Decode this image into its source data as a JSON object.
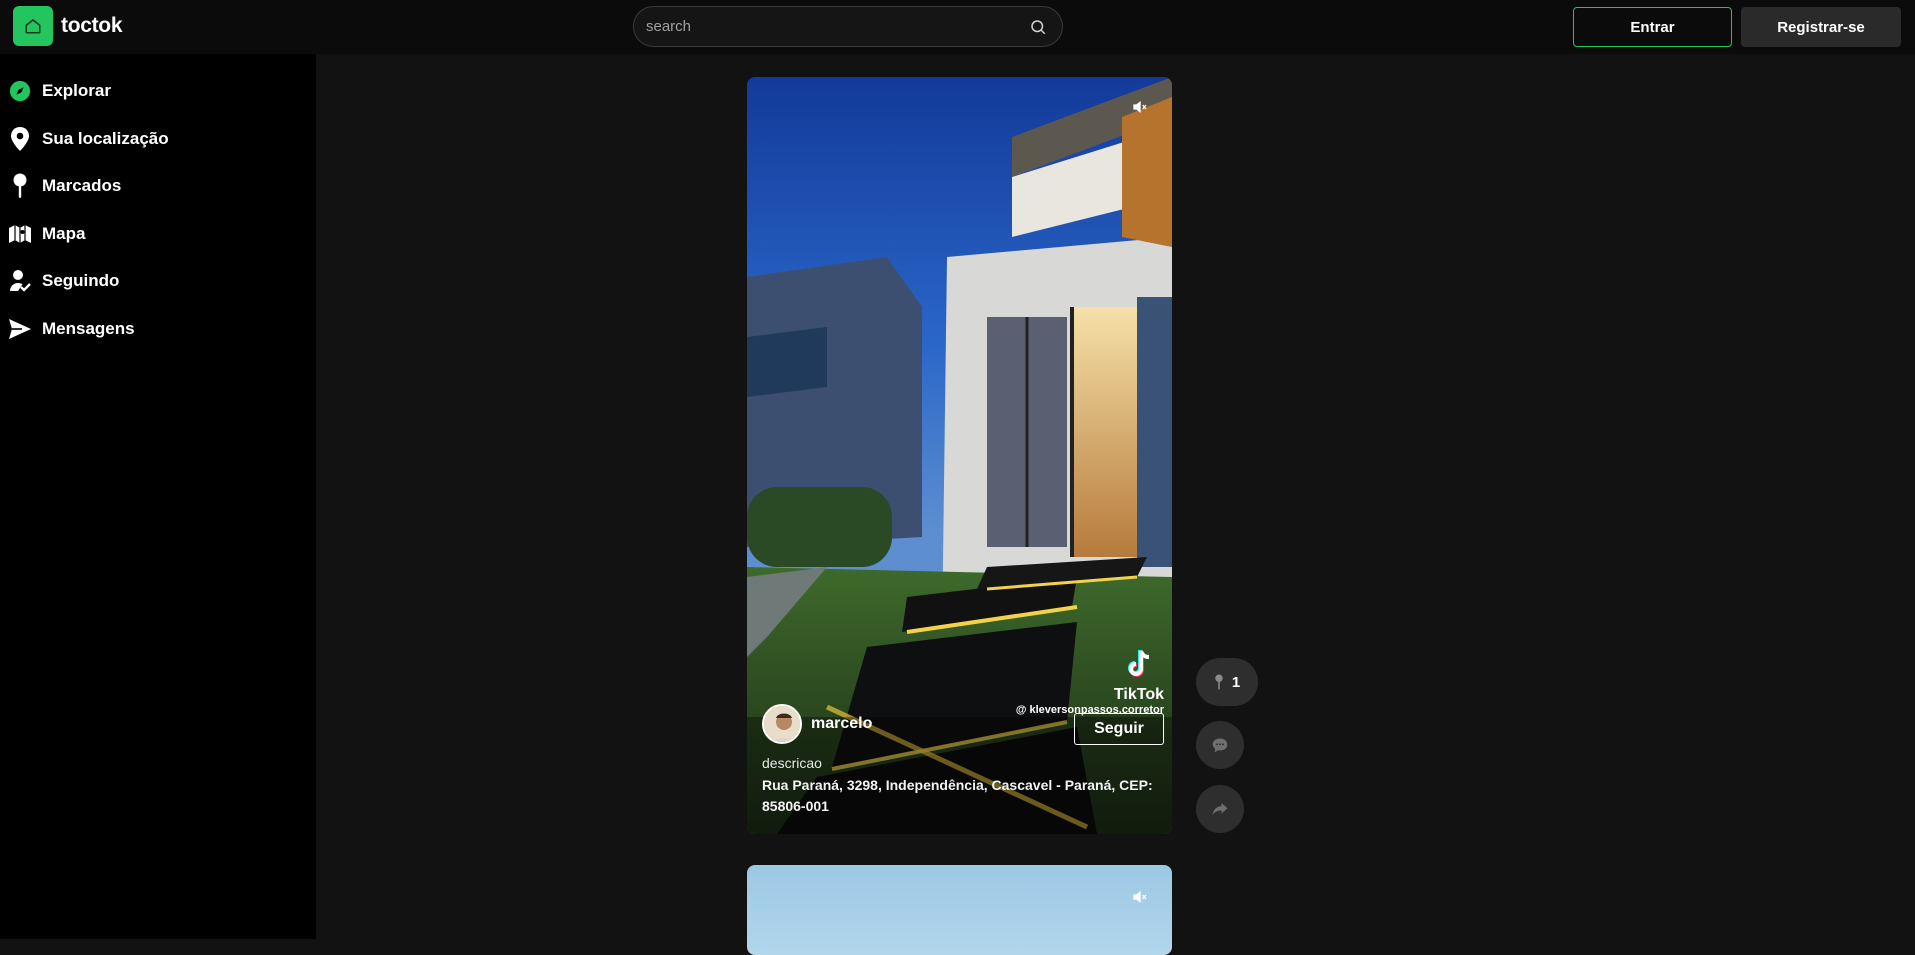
{
  "header": {
    "app_name": "toctok",
    "search_placeholder": "search",
    "login_label": "Entrar",
    "register_label": "Registrar-se"
  },
  "sidebar": {
    "items": [
      {
        "label": "Explorar",
        "icon": "compass-icon"
      },
      {
        "label": "Sua localização",
        "icon": "location-pin-icon"
      },
      {
        "label": "Marcados",
        "icon": "pushpin-icon"
      },
      {
        "label": "Mapa",
        "icon": "map-icon"
      },
      {
        "label": "Seguindo",
        "icon": "user-check-icon"
      },
      {
        "label": "Mensagens",
        "icon": "send-icon"
      }
    ]
  },
  "feed": {
    "post": {
      "watermark_name": "TikTok",
      "watermark_handle": "@ kleversonpassos.corretor",
      "author": "marcelo",
      "follow_label": "Seguir",
      "description": "descricao",
      "address": "Rua Paraná, 3298, Independência, Cascavel - Paraná, CEP: 85806-001",
      "pin_count": "1"
    }
  },
  "colors": {
    "accent": "#22c55e",
    "background": "#121212",
    "sidebar": "#000000",
    "header": "#0b0b0b"
  }
}
